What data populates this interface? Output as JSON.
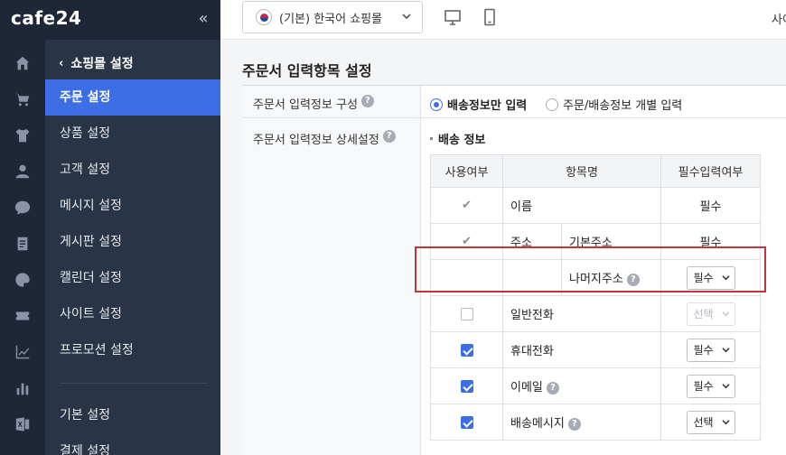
{
  "brand": {
    "logo_text": "cafe24",
    "collapse_glyph": "«"
  },
  "rail_icons": [
    "home-icon",
    "cart-icon",
    "shirt-icon",
    "user-icon",
    "chat-icon",
    "document-icon",
    "palette-icon",
    "coupon-icon",
    "trend-chart-icon",
    "bar-chart-icon",
    "excel-icon"
  ],
  "sidebar": {
    "back_label": "쇼핑몰 설정",
    "items": [
      {
        "label": "주문 설정",
        "active": true
      },
      {
        "label": "상품 설정"
      },
      {
        "label": "고객 설정"
      },
      {
        "label": "메시지 설정"
      },
      {
        "label": "게시판 설정"
      },
      {
        "label": "캘린더 설정"
      },
      {
        "label": "사이트 설정"
      },
      {
        "label": "프로모션 설정"
      },
      {
        "label": "기본 설정"
      },
      {
        "label": "결제 설정"
      }
    ]
  },
  "topbar": {
    "shop_select": "(기본) 한국어 쇼핑몰",
    "right_text": "사이"
  },
  "page": {
    "title": "주문서 입력항목 설정",
    "row1_label": "주문서 입력정보 구성",
    "row1_help": "?",
    "radio_option1": "배송정보만 입력",
    "radio_option2": "주문/배송정보 개별 입력",
    "row2_label": "주문서 입력정보 상세설정",
    "row2_help": "?",
    "section_title": "배송 정보",
    "table": {
      "headers": [
        "사용여부",
        "항목명",
        "필수입력여부"
      ],
      "rows": [
        {
          "name": "이름",
          "required": "필수",
          "use": "fixed"
        },
        {
          "group": "주소",
          "sub": "기본주소",
          "required": "필수",
          "use": "fixed"
        },
        {
          "sub": "나머지주소",
          "help": "?",
          "required_select": "필수"
        },
        {
          "name": "일반전화",
          "required_select": "선택",
          "use": "unchecked",
          "disabled": true
        },
        {
          "name": "휴대전화",
          "required_select": "필수",
          "use": "checked"
        },
        {
          "name": "이메일",
          "help": "?",
          "required_select": "필수",
          "use": "checked"
        },
        {
          "name": "배송메시지",
          "help": "?",
          "required_select": "선택",
          "use": "checked"
        }
      ],
      "fixed_mark": "✔"
    }
  },
  "colors": {
    "accent": "#3d6ee6",
    "sidebar_bg": "#2a3447",
    "rail_bg": "#1e2738",
    "highlight": "#c0343a"
  }
}
